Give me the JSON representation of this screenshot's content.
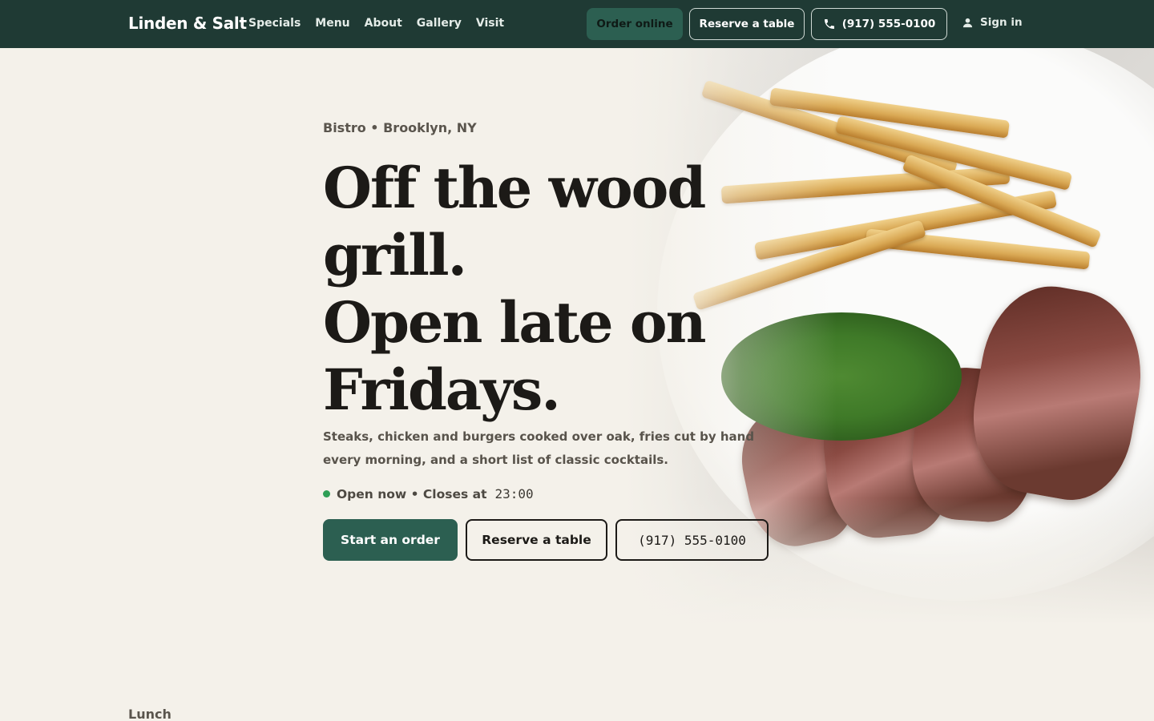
{
  "header": {
    "brand": "Linden & Salt",
    "nav": [
      "Specials",
      "Menu",
      "About",
      "Gallery",
      "Visit"
    ],
    "order_online": "Order online",
    "reserve": "Reserve a table",
    "phone": "(917) 555-0100",
    "sign_in": "Sign in"
  },
  "hero": {
    "eyebrow": "Bistro • Brooklyn, NY",
    "headline_lines": [
      "Off the wood",
      "grill.",
      "Open late on",
      "Fridays."
    ],
    "lede": "Steaks, chicken and burgers cooked over oak, fries cut by hand every morning, and a short list of classic cocktails.",
    "status_text": "Open now • Closes at",
    "status_time": "23:00",
    "status_color": "#2e9e55",
    "cta_primary": "Start an order",
    "cta_reserve": "Reserve a table",
    "cta_phone": "(917) 555-0100"
  },
  "next_section": {
    "label": "Lunch"
  },
  "colors": {
    "nav_bg": "#1f3a34",
    "accent": "#2c5f51",
    "page_bg": "#f4f1ea"
  },
  "icons": {
    "phone": "phone-icon",
    "user": "user-icon"
  }
}
